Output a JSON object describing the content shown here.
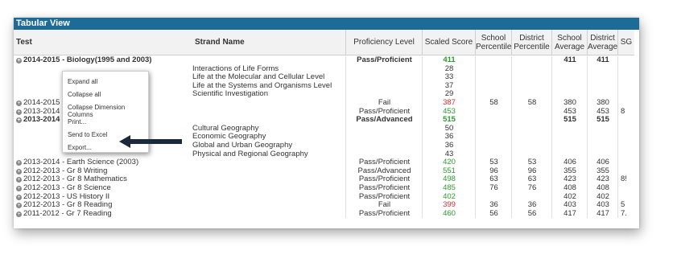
{
  "panel": {
    "title": "Tabular View"
  },
  "headers": {
    "test": "Test",
    "strand": "Strand Name",
    "proficiency": "Proficiency Level",
    "scaled_score": "Scaled Score",
    "school_percentile": "School Percentile",
    "district_percentile": "District Percentile",
    "school_average": "School Average",
    "district_average": "District Average",
    "sg": "SG"
  },
  "colors": {
    "title_bar": "#1d6b97",
    "green": "#2e9a2e",
    "red": "#d23030",
    "arrow": "#1a2a3a"
  },
  "rows": [
    {
      "test": "2014-2015 - Biology(1995 and 2003)",
      "strand": "",
      "prof": "Pass/Proficient",
      "score": "411",
      "score_color": "green",
      "sp": "",
      "dp": "",
      "sa": "411",
      "da": "411",
      "sg": "",
      "bold": true,
      "expander": true
    },
    {
      "test": "",
      "strand": "Interactions of Life Forms",
      "prof": "",
      "score": "28",
      "score_color": "",
      "sp": "",
      "dp": "",
      "sa": "",
      "da": "",
      "sg": "",
      "bold": false,
      "expander": false
    },
    {
      "test": "",
      "strand": "Life at the Molecular and Cellular Level",
      "prof": "",
      "score": "33",
      "score_color": "",
      "sp": "",
      "dp": "",
      "sa": "",
      "da": "",
      "sg": "",
      "bold": false,
      "expander": false
    },
    {
      "test": "",
      "strand": "Life at the Systems and Organisms Level",
      "prof": "",
      "score": "37",
      "score_color": "",
      "sp": "",
      "dp": "",
      "sa": "",
      "da": "",
      "sg": "",
      "bold": false,
      "expander": false
    },
    {
      "test": "",
      "strand": "Scientific Investigation",
      "prof": "",
      "score": "29",
      "score_color": "",
      "sp": "",
      "dp": "",
      "sa": "",
      "da": "",
      "sg": "",
      "bold": false,
      "expander": false
    },
    {
      "test": "2014-2015 -",
      "strand": "",
      "prof": "Fail",
      "score": "387",
      "score_color": "red",
      "sp": "58",
      "dp": "58",
      "sa": "380",
      "da": "380",
      "sg": "",
      "bold": false,
      "expander": true
    },
    {
      "test": "2013-2014 -",
      "strand": "",
      "prof": "Pass/Proficient",
      "score": "453",
      "score_color": "green",
      "sp": "",
      "dp": "",
      "sa": "453",
      "da": "453",
      "sg": "8",
      "bold": false,
      "expander": true
    },
    {
      "test": "2013-2014 -",
      "strand": "",
      "prof": "Pass/Advanced",
      "score": "515",
      "score_color": "green",
      "sp": "",
      "dp": "",
      "sa": "515",
      "da": "515",
      "sg": "",
      "bold": true,
      "expander": true
    },
    {
      "test": "",
      "strand": "Cultural Geography",
      "prof": "",
      "score": "50",
      "score_color": "",
      "sp": "",
      "dp": "",
      "sa": "",
      "da": "",
      "sg": "",
      "bold": false,
      "expander": false
    },
    {
      "test": "",
      "strand": "Economic Geography",
      "prof": "",
      "score": "36",
      "score_color": "",
      "sp": "",
      "dp": "",
      "sa": "",
      "da": "",
      "sg": "",
      "bold": false,
      "expander": false
    },
    {
      "test": "",
      "strand": "Global and Urban Geography",
      "prof": "",
      "score": "36",
      "score_color": "",
      "sp": "",
      "dp": "",
      "sa": "",
      "da": "",
      "sg": "",
      "bold": false,
      "expander": false
    },
    {
      "test": "",
      "strand": "Physical and Regional Geography",
      "prof": "",
      "score": "43",
      "score_color": "",
      "sp": "",
      "dp": "",
      "sa": "",
      "da": "",
      "sg": "",
      "bold": false,
      "expander": false
    },
    {
      "test": "2013-2014 - Earth Science (2003)",
      "strand": "",
      "prof": "Pass/Proficient",
      "score": "420",
      "score_color": "green",
      "sp": "53",
      "dp": "53",
      "sa": "406",
      "da": "406",
      "sg": "",
      "bold": false,
      "expander": true
    },
    {
      "test": "2012-2013 - Gr 8 Writing",
      "strand": "",
      "prof": "Pass/Advanced",
      "score": "551",
      "score_color": "green",
      "sp": "96",
      "dp": "96",
      "sa": "355",
      "da": "355",
      "sg": "",
      "bold": false,
      "expander": true
    },
    {
      "test": "2012-2013 - Gr 8 Mathematics",
      "strand": "",
      "prof": "Pass/Proficient",
      "score": "498",
      "score_color": "green",
      "sp": "63",
      "dp": "63",
      "sa": "423",
      "da": "423",
      "sg": "8!",
      "bold": false,
      "expander": true
    },
    {
      "test": "2012-2013 - Gr 8 Science",
      "strand": "",
      "prof": "Pass/Proficient",
      "score": "485",
      "score_color": "green",
      "sp": "76",
      "dp": "76",
      "sa": "408",
      "da": "408",
      "sg": "",
      "bold": false,
      "expander": true
    },
    {
      "test": "2012-2013 - US History II",
      "strand": "",
      "prof": "Pass/Proficient",
      "score": "402",
      "score_color": "green",
      "sp": "",
      "dp": "",
      "sa": "402",
      "da": "402",
      "sg": "",
      "bold": false,
      "expander": true
    },
    {
      "test": "2012-2013 - Gr 8 Reading",
      "strand": "",
      "prof": "Fail",
      "score": "399",
      "score_color": "red",
      "sp": "36",
      "dp": "36",
      "sa": "403",
      "da": "403",
      "sg": "5",
      "bold": false,
      "expander": true
    },
    {
      "test": "2011-2012 - Gr 7 Reading",
      "strand": "",
      "prof": "Pass/Proficient",
      "score": "460",
      "score_color": "green",
      "sp": "56",
      "dp": "56",
      "sa": "417",
      "da": "417",
      "sg": "7.",
      "bold": false,
      "expander": true
    }
  ],
  "context_menu": {
    "items": [
      "Expand all",
      "Collapse all",
      "Collapse Dimension Columns",
      "Print...",
      "Send to Excel",
      "Export..."
    ]
  }
}
